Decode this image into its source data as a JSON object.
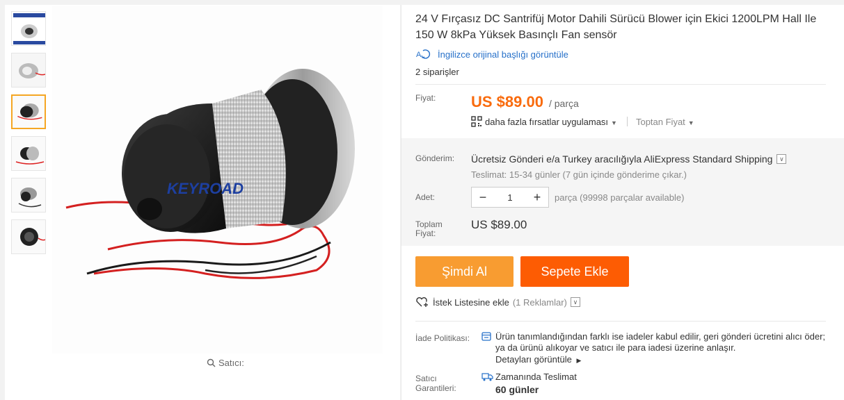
{
  "product": {
    "title": "24 V Fırçasız DC Santrifüj Motor Dahili Sürücü Blower için Ekici 1200LPM Hall Ile 150 W 8kPa Yüksek Basınçlı Fan sensör",
    "translate_link": "İngilizce orijinal başlığı görüntüle",
    "orders": "2 siparişler",
    "watermark": "KEYROAD"
  },
  "gallery": {
    "seller_search": "Satıcı:",
    "thumbnail_count": 6,
    "active_index": 2
  },
  "price": {
    "label": "Fiyat:",
    "value": "US $89.00",
    "unit": "/ parça",
    "deals": "daha fazla fırsatlar uygulaması",
    "wholesale": "Toptan Fiyat"
  },
  "shipping": {
    "label": "Gönderim:",
    "free": "Ücretsiz Gönderi",
    "via": "e/a Turkey aracılığıyla AliExpress Standard Shipping",
    "delivery": "Teslimat: 15-34 günler (7 gün içinde gönderime çıkar.)"
  },
  "quantity": {
    "label": "Adet:",
    "value": "1",
    "minus": "−",
    "plus": "+",
    "available": "parça (99998 parçalar available)"
  },
  "total": {
    "label_line1": "Toplam",
    "label_line2": "Fiyat:",
    "value": "US $89.00"
  },
  "actions": {
    "buy_now": "Şimdi Al",
    "add_to_cart": "Sepete Ekle",
    "wishlist": "İstek Listesine ekle",
    "wishlist_count": "(1 Reklamlar)"
  },
  "return_policy": {
    "label": "İade Politikası:",
    "text": "Ürün tanımlandığından farklı ise iadeler kabul edilir, geri gönderi ücretini alıcı öder; ya da ürünü alıkoyar ve satıcı ile para iadesi üzerine anlaşır.",
    "details": "Detayları görüntüle"
  },
  "guarantee": {
    "label_line1": "Satıcı",
    "label_line2": "Garantileri:",
    "title": "Zamanında Teslimat",
    "days": "60 günler"
  },
  "colors": {
    "price": "#f96b0d",
    "buy_now": "#f89c31",
    "add_to_cart": "#fd5c03",
    "link": "#2670c9",
    "active_thumb_border": "#f5a623"
  }
}
